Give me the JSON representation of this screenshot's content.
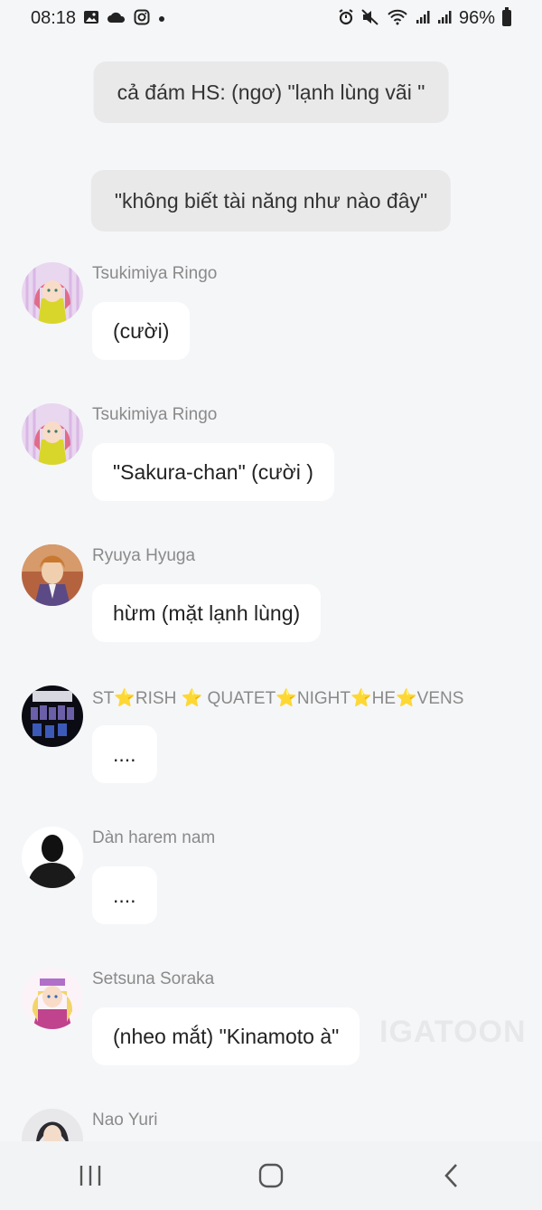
{
  "status_bar": {
    "time": "08:18",
    "battery": "96%",
    "left_icons": [
      "image-icon",
      "cloud-icon",
      "instagram-icon",
      "dot-icon"
    ],
    "right_icons": [
      "alarm-icon",
      "mute-icon",
      "wifi-icon",
      "signal-icon",
      "signal-icon",
      "battery-icon"
    ]
  },
  "narrations": [
    {
      "text": "cả đám HS: (ngơ) \"lạnh lùng vãi \""
    },
    {
      "text": "\"không biết tài năng như nào đây\""
    }
  ],
  "messages": [
    {
      "name": "Tsukimiya Ringo",
      "text": "(cười)"
    },
    {
      "name": "Tsukimiya Ringo",
      "text": "\"Sakura-chan\" (cười )"
    },
    {
      "name": "Ryuya Hyuga",
      "text": "hừm (mặt lạnh lùng)"
    },
    {
      "name": "ST⭐RISH ⭐ QUATET⭐NIGHT⭐HE⭐VENS",
      "text": "...."
    },
    {
      "name": "Dàn harem nam",
      "text": "...."
    },
    {
      "name": "Setsuna Soraka",
      "text": "(nheo mắt) \"Kinamoto à\""
    },
    {
      "name": "Nao Yuri",
      "text": ""
    }
  ],
  "watermark": "IGATOON",
  "nav_bar": {
    "items": [
      "recents-button",
      "home-button",
      "back-button"
    ]
  }
}
